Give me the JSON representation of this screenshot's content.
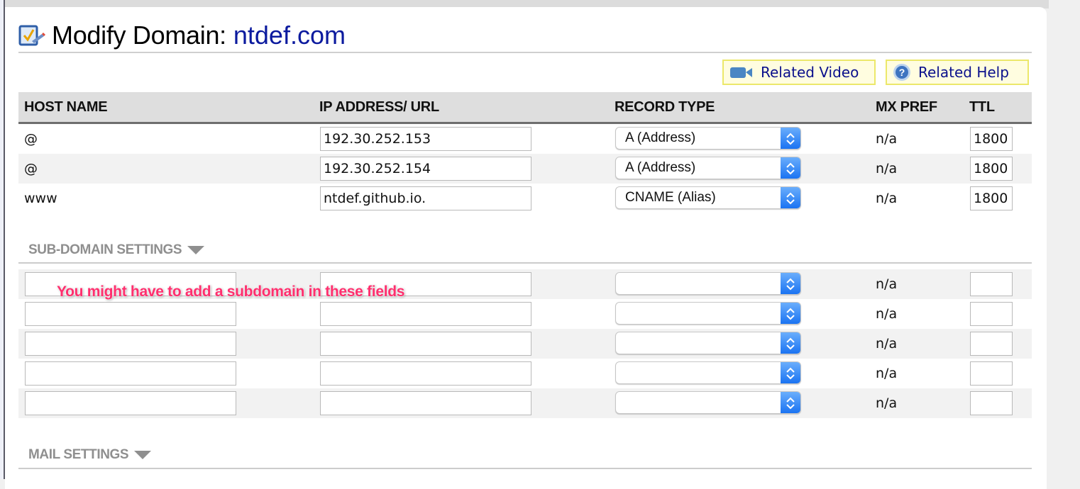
{
  "header": {
    "title": "Modify Domain:",
    "domain": "ntdef.com",
    "icon": "edit-checklist-icon"
  },
  "help_buttons": {
    "video": {
      "label": "Related Video",
      "icon": "video-camera-icon"
    },
    "help": {
      "label": "Related Help",
      "icon": "question-circle-icon"
    }
  },
  "table": {
    "columns": [
      "HOST NAME",
      "IP ADDRESS/ URL",
      "RECORD TYPE",
      "MX PREF",
      "TTL"
    ],
    "records": [
      {
        "host": "@",
        "address": "192.30.252.153",
        "type": "A (Address)",
        "mx_pref": "n/a",
        "ttl": "1800"
      },
      {
        "host": "@",
        "address": "192.30.252.154",
        "type": "A (Address)",
        "mx_pref": "n/a",
        "ttl": "1800"
      },
      {
        "host": "www",
        "address": "ntdef.github.io.",
        "type": "CNAME (Alias)",
        "mx_pref": "n/a",
        "ttl": "1800"
      }
    ]
  },
  "subdomain": {
    "heading": "SUB-DOMAIN SETTINGS",
    "rows": [
      {
        "host": "",
        "address": "",
        "type": "",
        "mx_pref": "n/a",
        "ttl": ""
      },
      {
        "host": "",
        "address": "",
        "type": "",
        "mx_pref": "n/a",
        "ttl": ""
      },
      {
        "host": "",
        "address": "",
        "type": "",
        "mx_pref": "n/a",
        "ttl": ""
      },
      {
        "host": "",
        "address": "",
        "type": "",
        "mx_pref": "n/a",
        "ttl": ""
      },
      {
        "host": "",
        "address": "",
        "type": "",
        "mx_pref": "n/a",
        "ttl": ""
      }
    ]
  },
  "mail": {
    "heading": "MAIL SETTINGS"
  },
  "annotation": {
    "text": "You might have to add a subdomain in these fields",
    "color": "#ff2f6e"
  },
  "colors": {
    "link": "#0b1a9e",
    "select_accent": "#1a73f2",
    "help_bg": "#fffde0"
  }
}
